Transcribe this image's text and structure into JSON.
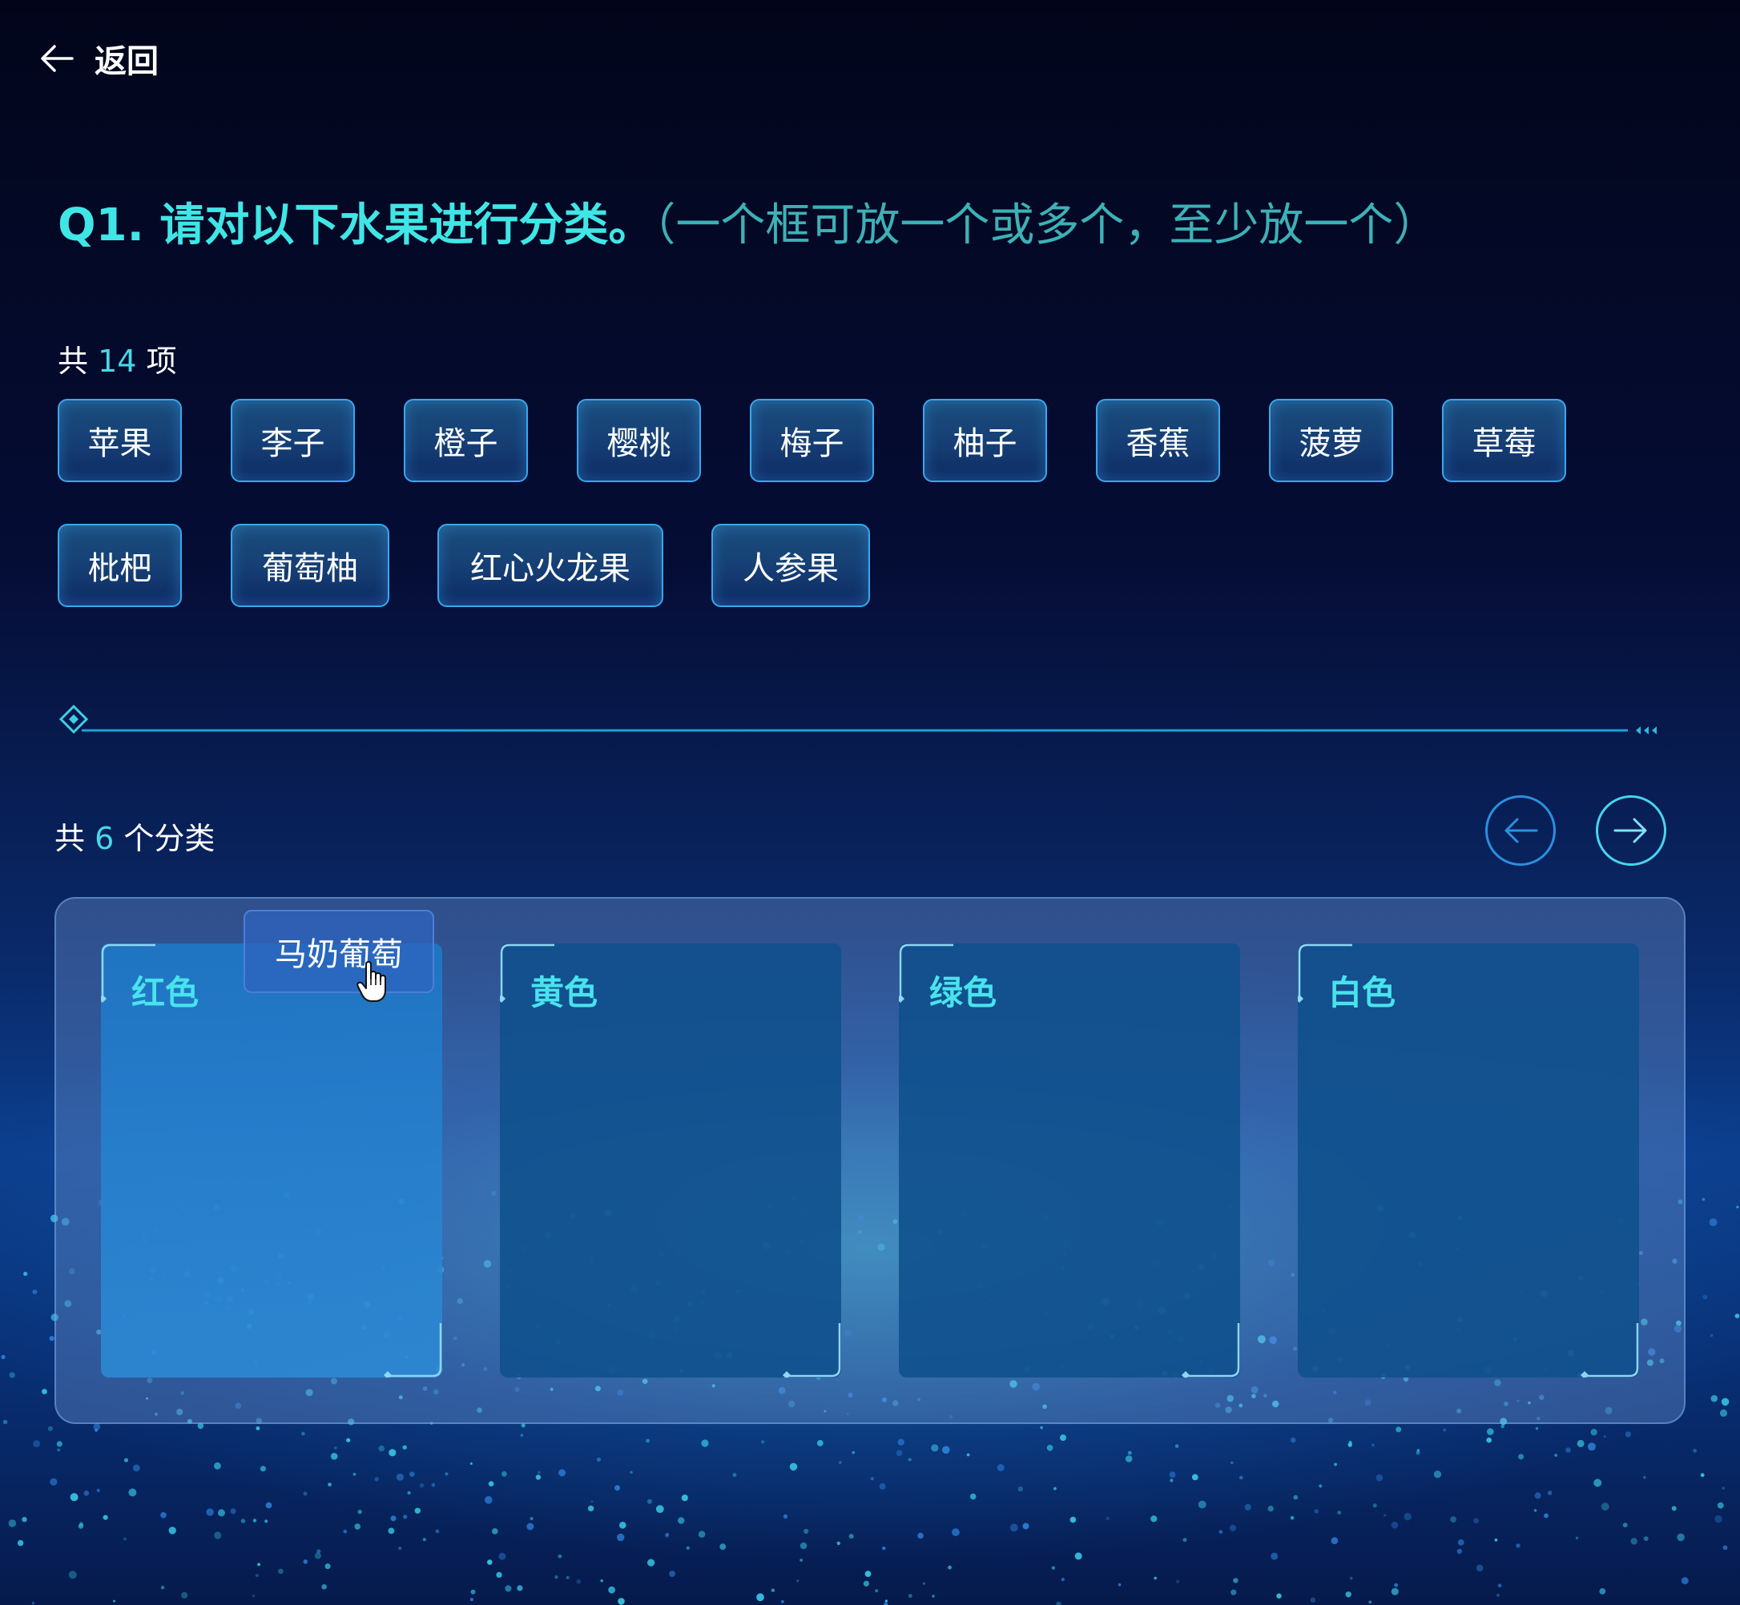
{
  "header": {
    "back_label": "返回"
  },
  "question": {
    "title": "Q1. 请对以下水果进行分类。",
    "hint": "（一个框可放一个或多个，至少放一个）"
  },
  "items_section": {
    "prefix": "共",
    "count": "14",
    "suffix": "项"
  },
  "items": [
    "苹果",
    "李子",
    "橙子",
    "樱桃",
    "梅子",
    "柚子",
    "香蕉",
    "菠萝",
    "草莓",
    "枇杷",
    "葡萄柚",
    "红心火龙果",
    "人参果"
  ],
  "dragging_item": "马奶葡萄",
  "categories_section": {
    "prefix": "共",
    "count": "6",
    "suffix": "个分类"
  },
  "categories": [
    "红色",
    "黄色",
    "绿色",
    "白色"
  ],
  "colors": {
    "accent_cyan": "#40e6e6",
    "chip_border": "#3aa7ef",
    "nav_prev": "#2b8fe0",
    "nav_next": "#47d4f0"
  },
  "icons": {
    "back": "arrow-left-icon",
    "prev": "arrow-left-icon",
    "next": "arrow-right-icon",
    "cursor": "hand-pointer-icon"
  }
}
